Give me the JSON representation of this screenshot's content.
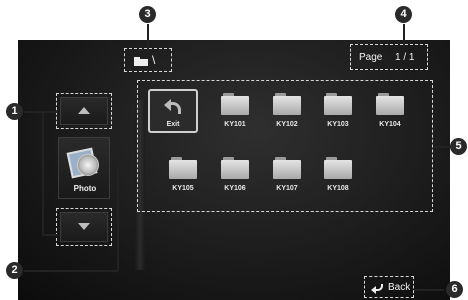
{
  "header": {
    "path_separator": "\\",
    "page_label": "Page",
    "page_value": "1 / 1"
  },
  "sidebar": {
    "up_icon": "triangle-up-icon",
    "down_icon": "triangle-down-icon",
    "photo_label": "Photo"
  },
  "folders": [
    {
      "label": "Exit",
      "icon": "return-arrow-icon"
    },
    {
      "label": "KY101",
      "icon": "folder-icon"
    },
    {
      "label": "KY102",
      "icon": "folder-icon"
    },
    {
      "label": "KY103",
      "icon": "folder-icon"
    },
    {
      "label": "KY104",
      "icon": "folder-icon"
    },
    {
      "label": "KY105",
      "icon": "folder-icon"
    },
    {
      "label": "KY106",
      "icon": "folder-icon"
    },
    {
      "label": "KY107",
      "icon": "folder-icon"
    },
    {
      "label": "KY108",
      "icon": "folder-icon"
    }
  ],
  "footer": {
    "back_label": "Back",
    "back_icon": "return-arrow-icon"
  },
  "callouts": {
    "c1": "1",
    "c2": "2",
    "c3": "3",
    "c4": "4",
    "c5": "5",
    "c6": "6"
  },
  "colors": {
    "screen_background": "#161616",
    "callout_fill": "#2a2a2a",
    "dashed_outline": "#d8d8d8"
  }
}
